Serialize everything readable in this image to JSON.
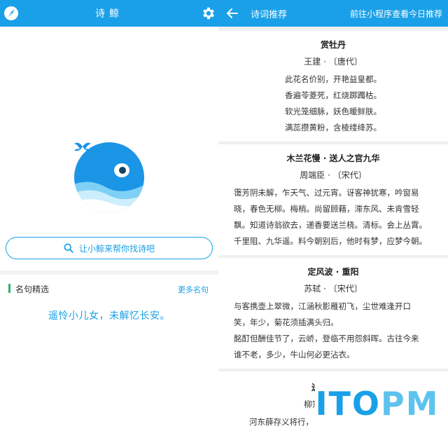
{
  "left": {
    "title": "诗鲸",
    "search_label": "让小鲸来帮你找诗吧",
    "section_title": "名句精选",
    "more_label": "更多名句",
    "quote": "遥怜小儿女，未解忆长安。"
  },
  "right": {
    "title": "诗词推荐",
    "action": "前往小程序查看今日推荐",
    "poems": [
      {
        "title": "赏牡丹",
        "author": "王建 · 〔唐代〕",
        "lines": [
          "此花名价别，开艳益皇都。",
          "香遍苓菱死，红烧踯躅枯。",
          "软光笼细脉，妖色暖鲜肤。",
          "满蕊攒黄粉，含棱缕绛苏。"
        ]
      },
      {
        "title": "木兰花慢 · 送人之官九华",
        "author": "周端臣 · 〔宋代〕",
        "lines": [
          "霭芳阴未解，乍天气、过元宵。讶客神犹寒，吟窗易",
          "晓，春色无柳。梅梢。尚留顾藉，滞东风、未肯雪轻",
          "飘。知道诗翁欲去，递香要送兰桡。清标。会上丛霄。",
          "千里阻、九华遥。料今朝别后，他时有梦，应梦今朝。"
        ]
      },
      {
        "title": "定风波 · 重阳",
        "author": "苏轼 · 〔宋代〕",
        "lines": [
          "与客携壶上翠微，江涵秋影雁初飞，尘世难逢开口",
          "笑，年少，菊花须插满头归。",
          "酩酊但酬佳节了，云峤，登临不用怨斜晖。古往今来",
          "谁不老，多少，牛山何必更沾衣。"
        ]
      },
      {
        "title": "送",
        "author": "柳宗",
        "lines": [
          "河东薛存义将行，"
        ]
      }
    ]
  },
  "watermark": {
    "part_a": "ITO",
    "part_b": "PM"
  }
}
